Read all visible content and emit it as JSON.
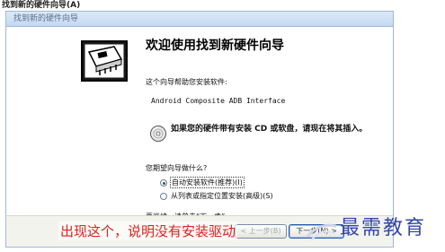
{
  "page_caption": "找到新的硬件向导(A)",
  "window": {
    "title": "找到新的硬件向导"
  },
  "wizard": {
    "heading": "欢迎使用找到新硬件向导",
    "intro": "这个向导帮助您安装软件:",
    "device_name": "Android Composite ADB Interface",
    "cd_note": "如果您的硬件带有安装 CD 或软盘，请现在将其插入。",
    "question": "您期望向导做什么?",
    "options": [
      {
        "label": "自动安装软件(推荐)(I)",
        "selected": true
      },
      {
        "label": "从列表或指定位置安装(高级)(S)",
        "selected": false
      }
    ],
    "continue_text": "要继续，请单击“下一步”。"
  },
  "buttons": {
    "back": "< 上一步(B)",
    "next": "下一步(N) >"
  },
  "overlay_annotation": "出现这个，说明没有安装驱动",
  "watermark": "最需教育",
  "colors": {
    "annotation": "#e0201e",
    "watermark": "#3346a8",
    "title_bar": "#c4d8f2"
  },
  "icons": {
    "hardware": "hardware-card-icon",
    "cd": "cd-icon"
  }
}
